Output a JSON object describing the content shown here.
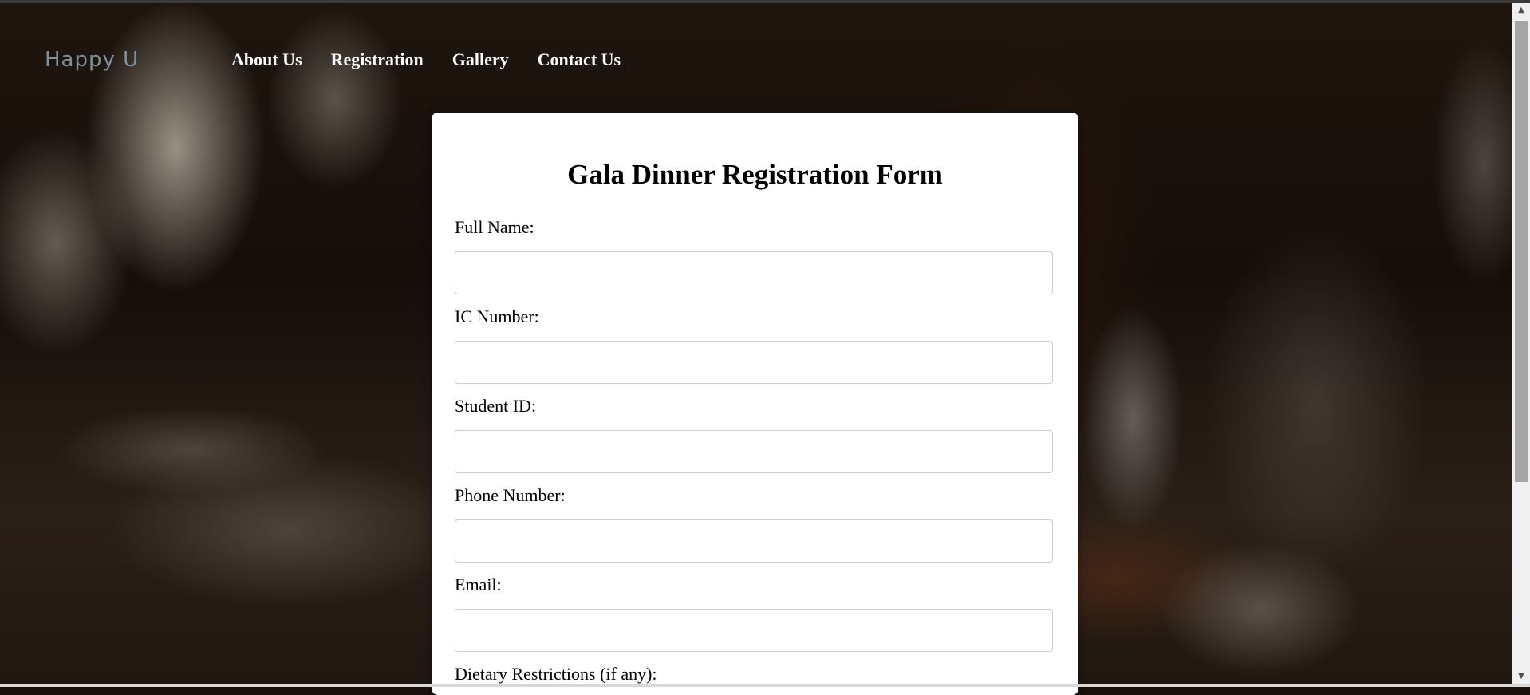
{
  "logo": {
    "text": "Happy U"
  },
  "nav": {
    "items": [
      "About Us",
      "Registration",
      "Gallery",
      "Contact Us"
    ]
  },
  "form": {
    "title": "Gala Dinner Registration Form",
    "fields": [
      {
        "label": "Full Name:",
        "value": ""
      },
      {
        "label": "IC Number:",
        "value": ""
      },
      {
        "label": "Student ID:",
        "value": ""
      },
      {
        "label": "Phone Number:",
        "value": ""
      },
      {
        "label": "Email:",
        "value": ""
      },
      {
        "label": "Dietary Restrictions (if any):",
        "value": ""
      }
    ]
  },
  "icons": {
    "scroll_up": "scroll-up-arrow-icon",
    "scroll_down": "scroll-down-arrow-icon"
  },
  "colors": {
    "nav_text": "#ffffff",
    "logo_text": "#7f8f9c",
    "card_bg": "#ffffff",
    "input_border": "#cccccc"
  }
}
